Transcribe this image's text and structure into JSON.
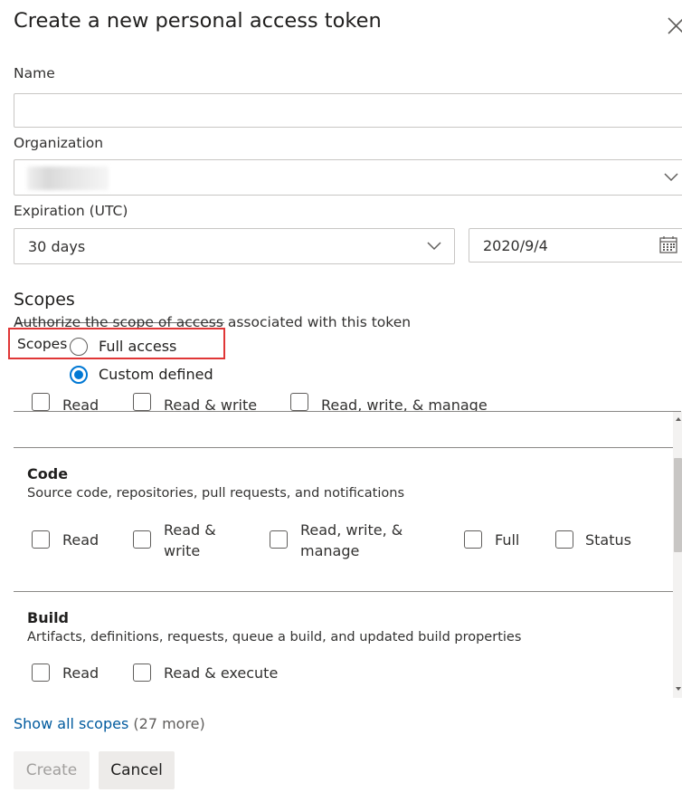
{
  "dialog": {
    "title": "Create a new personal access token",
    "close_icon": "close-icon"
  },
  "name": {
    "label": "Name",
    "value": ""
  },
  "organization": {
    "label": "Organization",
    "value": ""
  },
  "expiration": {
    "label": "Expiration (UTC)",
    "duration": "30 days",
    "date": "2020/9/4"
  },
  "scopes": {
    "heading": "Scopes",
    "description": "Authorize the scope of access associated with this token",
    "inline_label": "Scopes",
    "options": [
      {
        "label": "Full access",
        "checked": false
      },
      {
        "label": "Custom defined",
        "checked": true
      }
    ],
    "partial_row": [
      "Read",
      "Read & write",
      "Read, write, & manage"
    ],
    "sections": [
      {
        "title": "Code",
        "description": "Source code, repositories, pull requests, and notifications",
        "options": [
          "Read",
          "Read &\nwrite",
          "Read, write, &\nmanage",
          "Full",
          "Status"
        ]
      },
      {
        "title": "Build",
        "description": "Artifacts, definitions, requests, queue a build, and updated build properties",
        "options": [
          "Read",
          "Read & execute"
        ]
      }
    ],
    "show_all_link": "Show all scopes",
    "more_count": "(27 more)"
  },
  "footer": {
    "create_label": "Create",
    "cancel_label": "Cancel"
  },
  "colors": {
    "accent": "#0078d4",
    "highlight_box": "#e03636",
    "link": "#005a9e"
  }
}
